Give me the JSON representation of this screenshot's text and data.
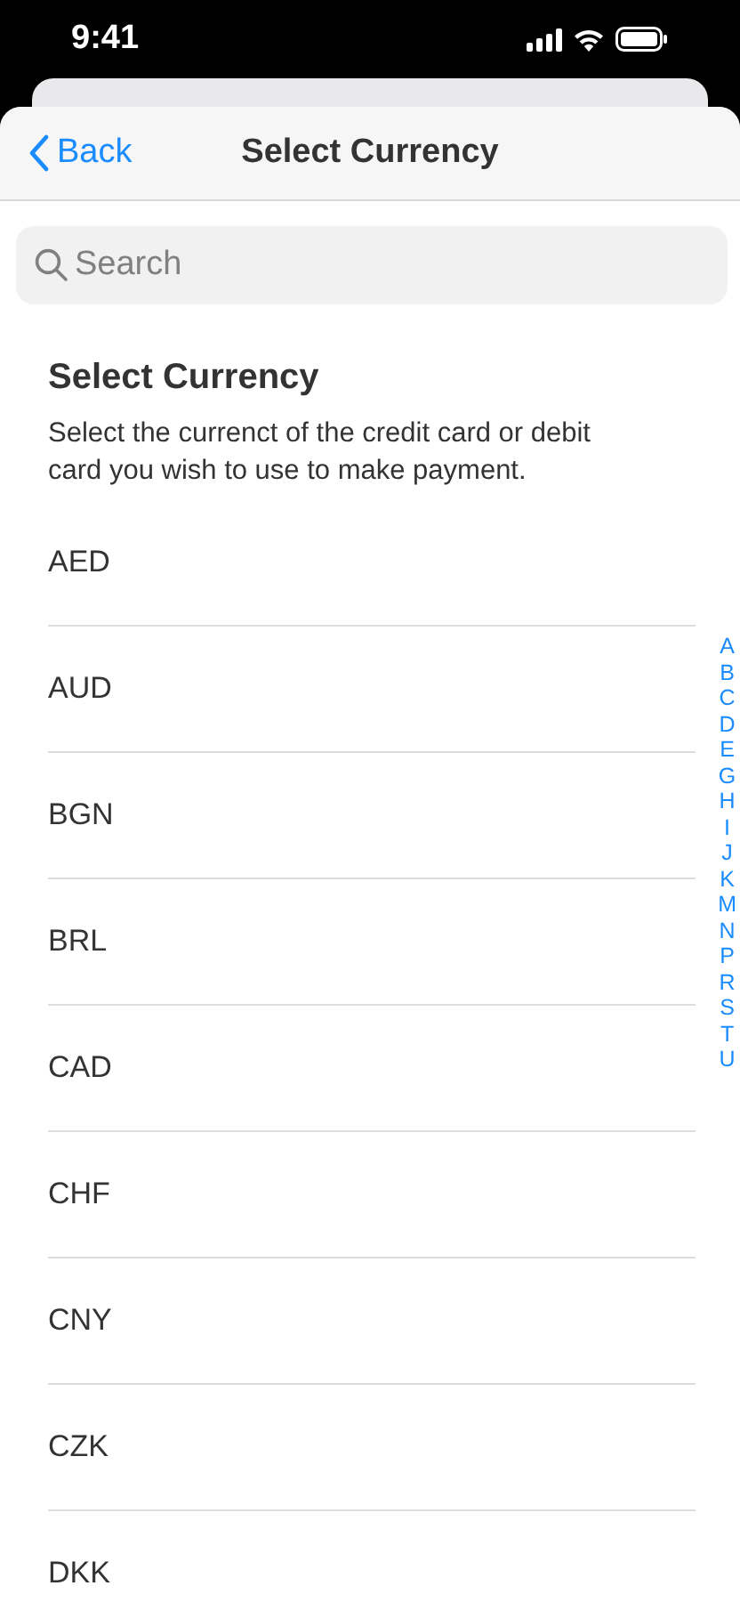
{
  "status_bar": {
    "time": "9:41"
  },
  "nav": {
    "back": "Back",
    "title": "Select Currency"
  },
  "search": {
    "placeholder": "Search"
  },
  "heading": "Select Currency",
  "description": "Select the currenct of the credit card or debit card you wish to use to make payment.",
  "currencies": [
    "AED",
    "AUD",
    "BGN",
    "BRL",
    "CAD",
    "CHF",
    "CNY",
    "CZK",
    "DKK"
  ],
  "index": [
    "A",
    "B",
    "C",
    "D",
    "E",
    "G",
    "H",
    "I",
    "J",
    "K",
    "M",
    "N",
    "P",
    "R",
    "S",
    "T",
    "U"
  ]
}
